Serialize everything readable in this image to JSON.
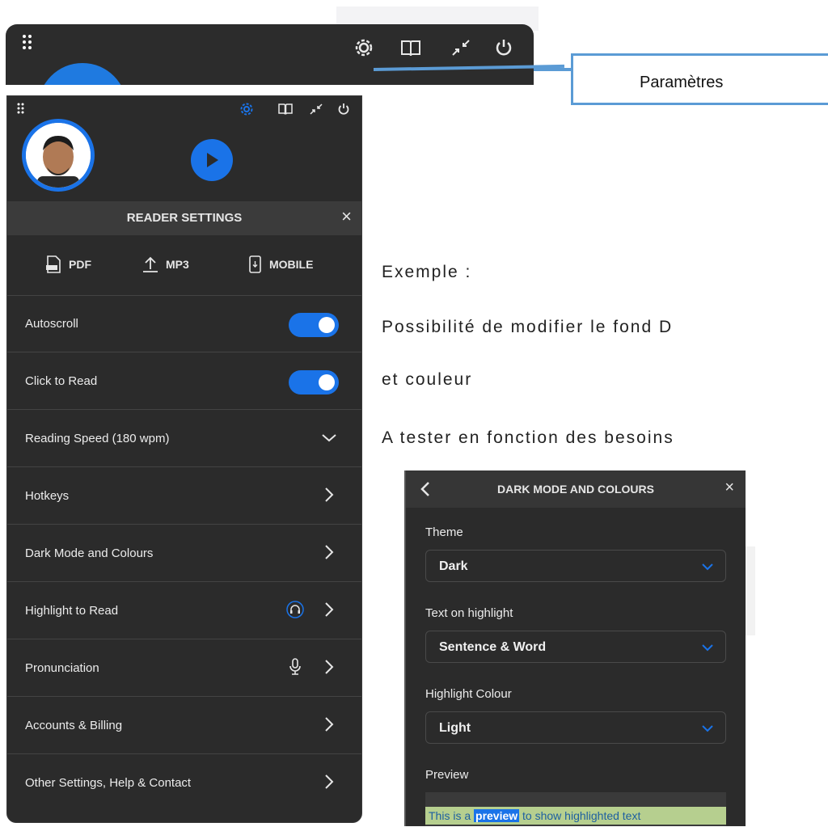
{
  "callout": {
    "label": "Paramètres"
  },
  "main_panel": {
    "section_title": "READER SETTINGS",
    "close_glyph": "×",
    "exports": [
      {
        "label": "PDF",
        "icon": "pdf-file-icon"
      },
      {
        "label": "MP3",
        "icon": "upload-icon"
      },
      {
        "label": "MOBILE",
        "icon": "mobile-icon"
      }
    ],
    "settings": [
      {
        "label": "Autoscroll",
        "control": "toggle",
        "on": true
      },
      {
        "label": "Click to Read",
        "control": "toggle",
        "on": true
      },
      {
        "label": "Reading Speed (180 wpm)",
        "control": "chevron-down"
      },
      {
        "label": "Hotkeys",
        "control": "chevron-right"
      },
      {
        "label": "Dark Mode and Colours",
        "control": "chevron-right"
      },
      {
        "label": "Highlight to Read",
        "control": "chevron-right",
        "extra_icon": "headphones-icon"
      },
      {
        "label": "Pronunciation",
        "control": "chevron-right",
        "extra_icon": "microphone-icon"
      },
      {
        "label": "Accounts & Billing",
        "control": "chevron-right"
      },
      {
        "label": "Other Settings, Help & Contact",
        "control": "chevron-right"
      }
    ]
  },
  "example": {
    "line1": "Exemple :",
    "line2": "Possibilité de modifier le fond D",
    "line3": "et couleur",
    "line4": "A tester en fonction des besoins"
  },
  "dark_mode_panel": {
    "title": "DARK MODE AND COLOURS",
    "close_glyph": "×",
    "theme_label": "Theme",
    "theme_value": "Dark",
    "text_on_highlight_label": "Text on highlight",
    "text_on_highlight_value": "Sentence & Word",
    "highlight_colour_label": "Highlight Colour",
    "highlight_colour_value": "Light",
    "preview_label": "Preview",
    "preview_before": "This is a ",
    "preview_word": "preview",
    "preview_after": " to show highlighted text"
  },
  "colors": {
    "accent": "#1a73e8",
    "panel_bg": "#2b2b2b",
    "callout_border": "#5b9bd5"
  }
}
